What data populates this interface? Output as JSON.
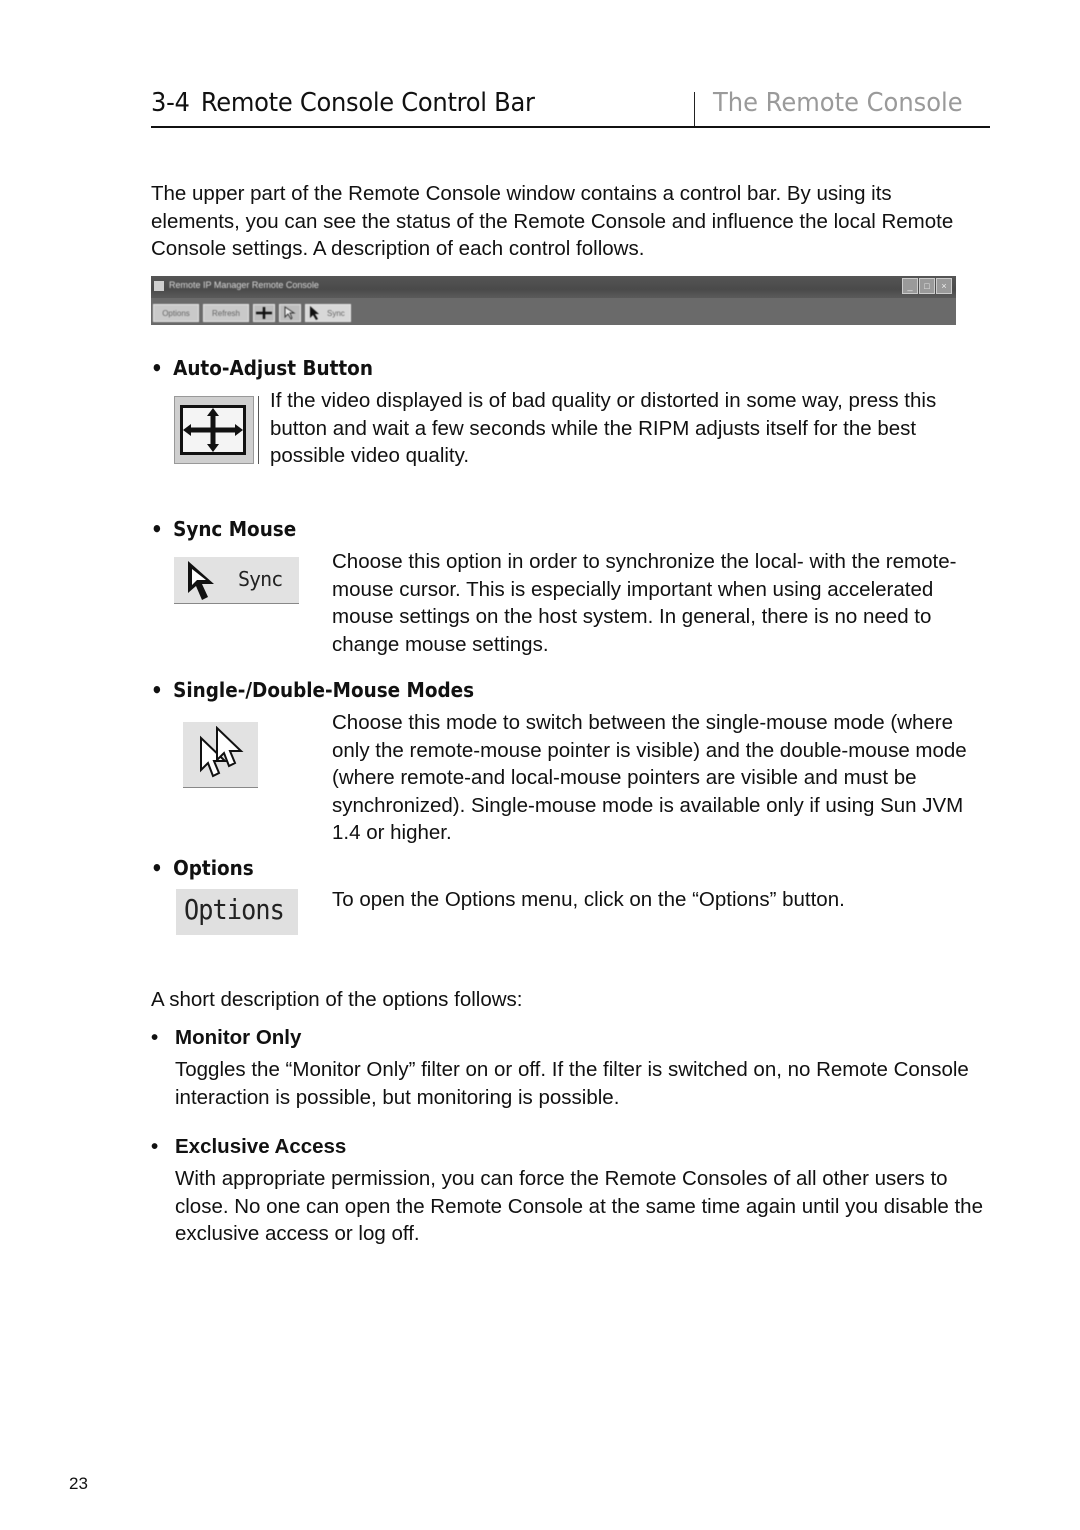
{
  "header": {
    "section_number": "3-4",
    "title": "Remote Console Control Bar",
    "chapter": "The Remote Console"
  },
  "intro": "The upper part of the Remote Console window contains a control bar. By using its elements, you can see the status of the Remote Console and influence the local Remote Console settings. A description of each control follows.",
  "control_bar": {
    "window_title": "Remote IP Manager Remote Console",
    "buttons": [
      "Options",
      "Refresh"
    ],
    "sync_label": "Sync",
    "window_controls": [
      "_",
      "□",
      "×"
    ]
  },
  "sections": [
    {
      "heading": "Auto-Adjust Button",
      "icon": "auto-adjust-icon",
      "description": "If the video displayed is of bad quality or distorted in some way, press this button and wait a few seconds while the RIPM adjusts itself for the best possible video quality."
    },
    {
      "heading": "Sync Mouse",
      "icon": "sync-mouse-icon",
      "icon_label": "Sync",
      "description": "Choose this option in order to synchronize the local- with the remote-mouse cursor. This is especially important when using accelerated mouse settings on the host system. In general, there is no need to change mouse settings."
    },
    {
      "heading": "Single-/Double-Mouse Modes",
      "icon": "double-mouse-icon",
      "description": "Choose this mode to switch between the single-mouse mode (where only the remote-mouse pointer is visible) and the double-mouse mode (where remote-and local-mouse pointers are visible and must be synchronized). Single-mouse mode is available only if using Sun JVM 1.4 or higher."
    },
    {
      "heading": "Options",
      "icon": "options-button-image",
      "icon_label": "Options",
      "description": "To open the Options menu, click on the “Options” button."
    }
  ],
  "options_intro": "A short description of the options follows:",
  "options": [
    {
      "heading": "Monitor Only",
      "description": "Toggles the “Monitor Only” filter on or off. If the filter is switched on, no Remote Console interaction is possible, but monitoring is possible."
    },
    {
      "heading": "Exclusive Access",
      "description": "With appropriate permission, you can force the Remote Consoles of all other users to close. No one can open the Remote Console at the same time again until you disable the exclusive access or log off."
    }
  ],
  "bullet": "•",
  "page_number": "23"
}
